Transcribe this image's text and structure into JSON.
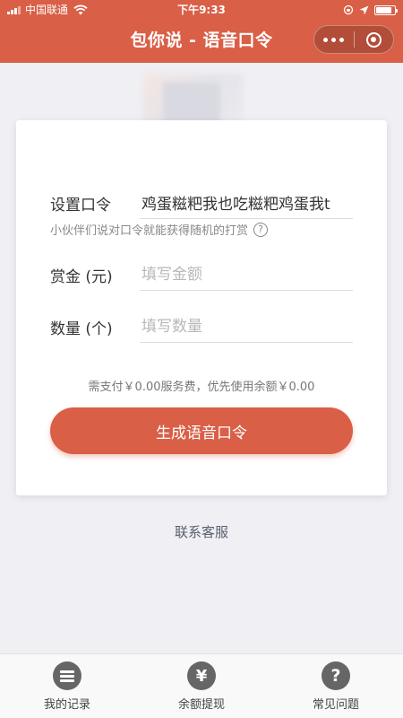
{
  "status_bar": {
    "carrier": "中国联通",
    "time": "下午9:33",
    "battery_level": 0.85
  },
  "nav": {
    "title": "包你说 - 语音口令"
  },
  "form": {
    "password": {
      "label": "设置口令",
      "value": "鸡蛋糍粑我也吃糍粑鸡蛋我t"
    },
    "hint": "小伙伴们说对口令就能获得随机的打赏",
    "amount": {
      "label": "赏金 (元)",
      "placeholder": "填写金额"
    },
    "count": {
      "label": "数量 (个)",
      "placeholder": "填写数量"
    },
    "fee_text": "需支付￥0.00服务费，优先使用余额￥0.00",
    "submit_label": "生成语音口令"
  },
  "contact_label": "联系客服",
  "tabbar": {
    "items": [
      {
        "label": "我的记录",
        "icon": "list-icon"
      },
      {
        "label": "余额提现",
        "icon": "yen-icon"
      },
      {
        "label": "常见问题",
        "icon": "question-icon"
      }
    ]
  },
  "colors": {
    "brand": "#d95f47",
    "background": "#efeff4",
    "tab_icon": "#666666"
  }
}
